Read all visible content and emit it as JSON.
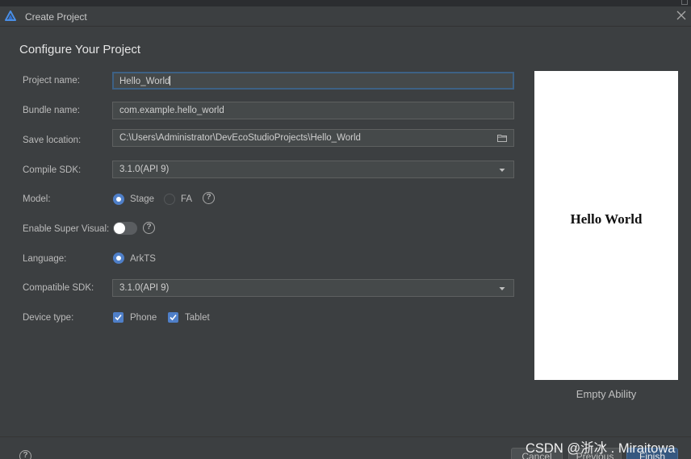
{
  "window": {
    "title": "Create Project"
  },
  "page": {
    "heading": "Configure Your Project"
  },
  "form": {
    "project_name": {
      "label": "Project name:",
      "value": "Hello_World"
    },
    "bundle_name": {
      "label": "Bundle name:",
      "value": "com.example.hello_world"
    },
    "save_location": {
      "label": "Save location:",
      "value": "C:\\Users\\Administrator\\DevEcoStudioProjects\\Hello_World"
    },
    "compile_sdk": {
      "label": "Compile SDK:",
      "value": "3.1.0(API 9)"
    },
    "model": {
      "label": "Model:",
      "options": [
        "Stage",
        "FA"
      ],
      "selected": "Stage"
    },
    "super_visual": {
      "label": "Enable Super Visual:",
      "enabled": false
    },
    "language": {
      "label": "Language:",
      "options": [
        "ArkTS"
      ],
      "selected": "ArkTS"
    },
    "compatible_sdk": {
      "label": "Compatible SDK:",
      "value": "3.1.0(API 9)"
    },
    "device_type": {
      "label": "Device type:",
      "options": [
        "Phone",
        "Tablet"
      ],
      "checked": [
        "Phone",
        "Tablet"
      ]
    }
  },
  "preview": {
    "text": "Hello World",
    "template_name": "Empty Ability"
  },
  "footer": {
    "cancel": "Cancel",
    "previous": "Previous",
    "finish": "Finish"
  },
  "help_glyph": "?",
  "watermark": "CSDN @浙冰 . Miraitowa",
  "colors": {
    "background": "#3c3f41",
    "accent": "#4f7fc8",
    "focus_border": "#3d6185",
    "primary_button": "#365880"
  },
  "icons": {
    "app": "harmony-triangle-icon",
    "close": "close-icon",
    "folder": "folder-icon",
    "dropdown": "chevron-down-icon",
    "help": "help-icon",
    "check": "checkmark-icon"
  }
}
